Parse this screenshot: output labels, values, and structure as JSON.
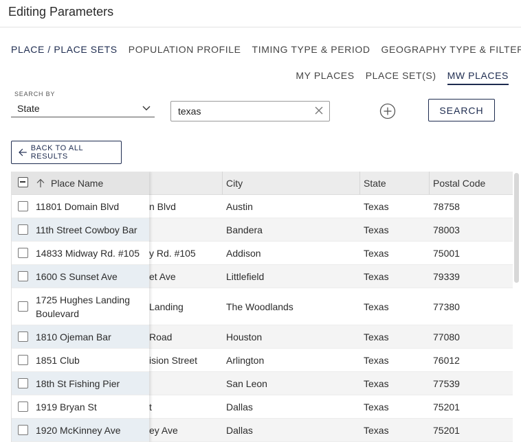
{
  "dialog": {
    "title": "Editing Parameters"
  },
  "main_tabs": [
    {
      "label": "PLACE / PLACE SETS"
    },
    {
      "label": "POPULATION PROFILE"
    },
    {
      "label": "TIMING TYPE & PERIOD"
    },
    {
      "label": "GEOGRAPHY TYPE & FILTER"
    }
  ],
  "sub_tabs": [
    {
      "label": "MY PLACES"
    },
    {
      "label": "PLACE SET(S)"
    },
    {
      "label": "MW PLACES"
    }
  ],
  "search": {
    "by_label": "SEARCH BY",
    "by_value": "State",
    "query": "texas",
    "button_label": "SEARCH"
  },
  "back_button": {
    "label": "BACK TO ALL RESULTS"
  },
  "colors": {
    "accent": "#1d2b4f",
    "header_bg": "#ececec",
    "row_alt": "#f4f4f4",
    "sticky_alt": "#e8eef3"
  },
  "table": {
    "columns": [
      "Place Name",
      "City",
      "State",
      "Postal Code"
    ],
    "rows": [
      {
        "name": "11801 Domain Blvd",
        "name_under": "n Blvd",
        "city": "Austin",
        "state": "Texas",
        "postal": "78758"
      },
      {
        "name": "11th Street Cowboy Bar",
        "name_under": "",
        "city": "Bandera",
        "state": "Texas",
        "postal": "78003"
      },
      {
        "name": "14833 Midway Rd. #105",
        "name_under": "y Rd. #105",
        "city": "Addison",
        "state": "Texas",
        "postal": "75001"
      },
      {
        "name": "1600 S Sunset Ave",
        "name_under": "et Ave",
        "city": "Littlefield",
        "state": "Texas",
        "postal": "79339"
      },
      {
        "name": "1725 Hughes Landing",
        "name_line2": "Boulevard",
        "name_under": "Landing",
        "city": "The Woodlands",
        "state": "Texas",
        "postal": "77380"
      },
      {
        "name": "1810 Ojeman Bar",
        "name_under": "Road",
        "city": "Houston",
        "state": "Texas",
        "postal": "77080"
      },
      {
        "name": "1851 Club",
        "name_under": "ision Street",
        "city": "Arlington",
        "state": "Texas",
        "postal": "76012"
      },
      {
        "name": "18th St Fishing Pier",
        "name_under": "",
        "city": "San Leon",
        "state": "Texas",
        "postal": "77539"
      },
      {
        "name": "1919 Bryan St",
        "name_under": "t",
        "city": "Dallas",
        "state": "Texas",
        "postal": "75201"
      },
      {
        "name": "1920 McKinney Ave",
        "name_under": "ey Ave",
        "city": "Dallas",
        "state": "Texas",
        "postal": "75201"
      }
    ]
  }
}
